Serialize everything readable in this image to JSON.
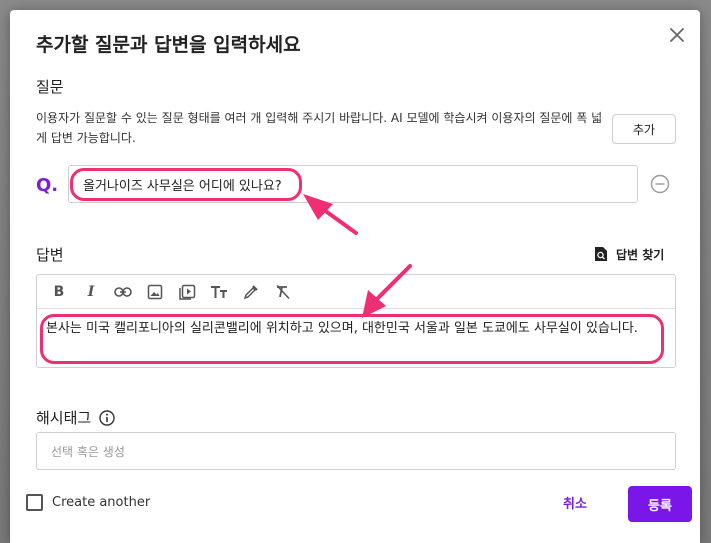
{
  "dialog": {
    "title": "추가할 질문과 답변을 입력하세요"
  },
  "question_section": {
    "label": "질문",
    "description": "이용자가 질문할 수 있는 질문 형태를 여러 개 입력해 주시기 바랍니다. AI 모델에 학습시켜 이용자의 질문에 폭 넓게 답변 가능합니다.",
    "add_label": "추가",
    "q_prefix": "Q.",
    "question_value": "올거나이즈 사무실은 어디에 있나요?"
  },
  "answer_section": {
    "label": "답변",
    "find_answer_label": "답변 찾기",
    "toolbar_icons": [
      "bold-icon",
      "italic-icon",
      "link-icon",
      "image-icon",
      "video-icon",
      "text-size-icon",
      "color-picker-icon",
      "clear-format-icon"
    ],
    "answer_text": "본사는 미국 캘리포니아의 실리콘밸리에 위치하고 있으며, 대한민국 서울과 일본 도쿄에도 사무실이 있습니다."
  },
  "hashtag_section": {
    "label": "해시태그",
    "placeholder": "선택 혹은 생성"
  },
  "footer": {
    "create_another_label": "Create another",
    "cancel_label": "취소",
    "submit_label": "등록"
  },
  "colors": {
    "accent": "#7b16e8",
    "highlight": "#ee2f74"
  }
}
